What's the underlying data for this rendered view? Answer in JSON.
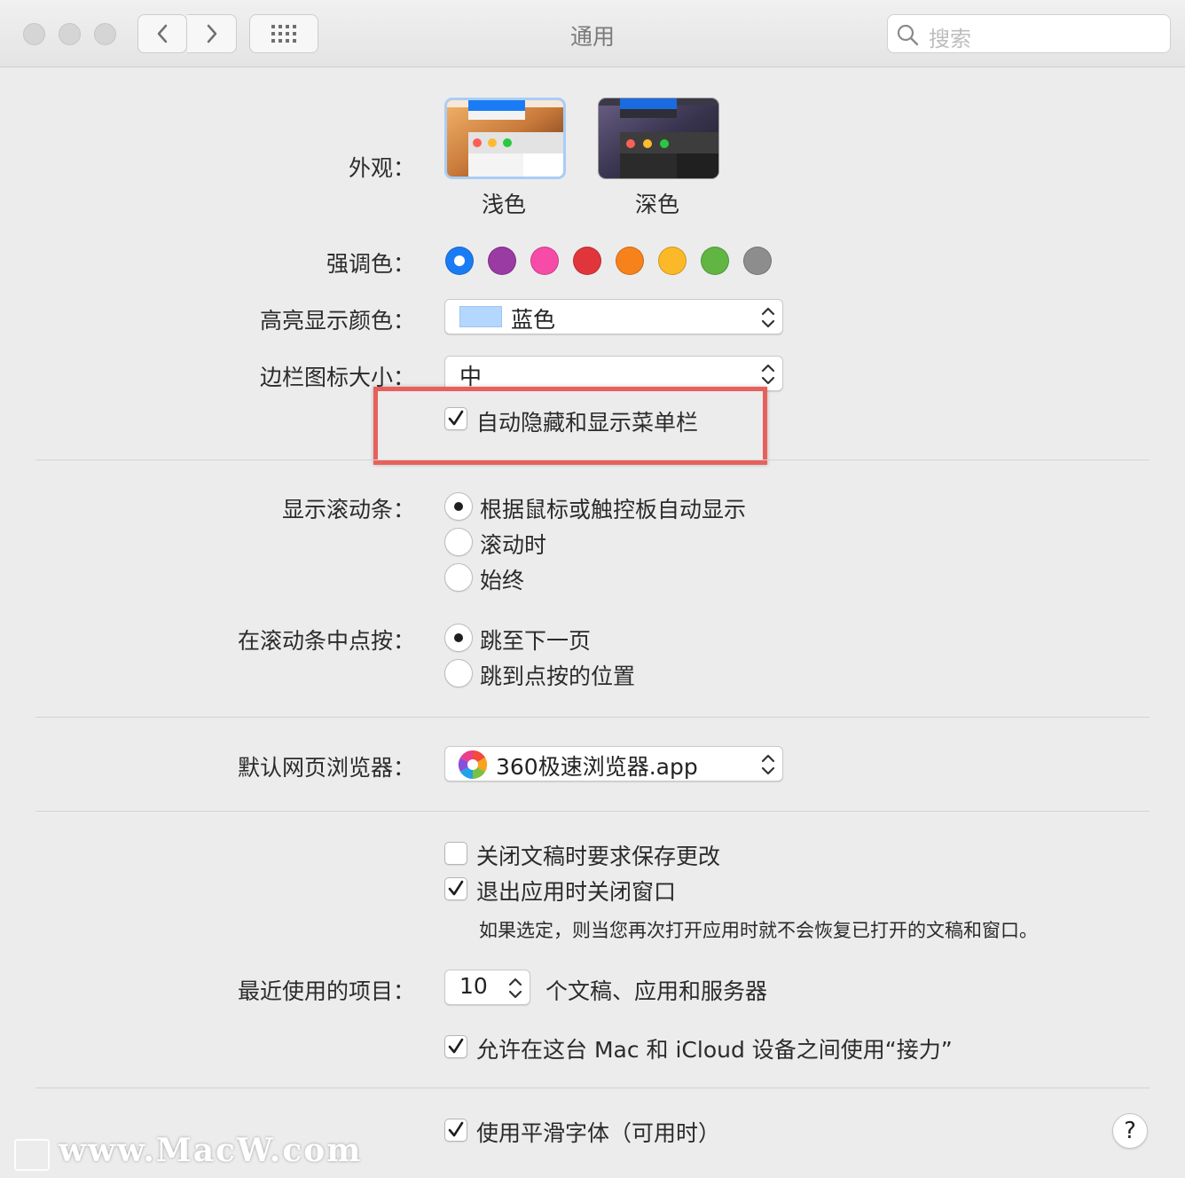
{
  "window": {
    "title": "通用",
    "search_placeholder": "搜索"
  },
  "appearance": {
    "label": "外观：",
    "options": [
      {
        "name": "浅色",
        "selected": true
      },
      {
        "name": "深色",
        "selected": false
      }
    ]
  },
  "accent": {
    "label": "强调色：",
    "colors": [
      "#1a7cf4",
      "#9a3aa3",
      "#f74ba8",
      "#e1353c",
      "#f7821b",
      "#fcb927",
      "#61b542",
      "#8d8d8d"
    ],
    "selected_index": 0
  },
  "highlight_color": {
    "label": "高亮显示颜色：",
    "value": "蓝色",
    "swatch": "#b3d7ff"
  },
  "sidebar_icon_size": {
    "label": "边栏图标大小：",
    "value": "中"
  },
  "menubar": {
    "label": "自动隐藏和显示菜单栏",
    "checked": true
  },
  "scrollbars": {
    "label": "显示滚动条：",
    "options": [
      "根据鼠标或触控板自动显示",
      "滚动时",
      "始终"
    ],
    "selected_index": 0
  },
  "scroll_click": {
    "label": "在滚动条中点按：",
    "options": [
      "跳至下一页",
      "跳到点按的位置"
    ],
    "selected_index": 0
  },
  "browser": {
    "label": "默认网页浏览器：",
    "value": "360极速浏览器.app"
  },
  "documents": {
    "ask_save": {
      "label": "关闭文稿时要求保存更改",
      "checked": false
    },
    "close_windows": {
      "label": "退出应用时关闭窗口",
      "checked": true
    },
    "note": "如果选定，则当您再次打开应用时就不会恢复已打开的文稿和窗口。"
  },
  "recent": {
    "label": "最近使用的项目：",
    "value": "10",
    "suffix": "个文稿、应用和服务器"
  },
  "handoff": {
    "label": "允许在这台 Mac 和 iCloud 设备之间使用“接力”",
    "checked": true
  },
  "smoothing": {
    "label": "使用平滑字体（可用时）",
    "checked": true
  },
  "help": "?",
  "watermark": "www.MacW.com"
}
